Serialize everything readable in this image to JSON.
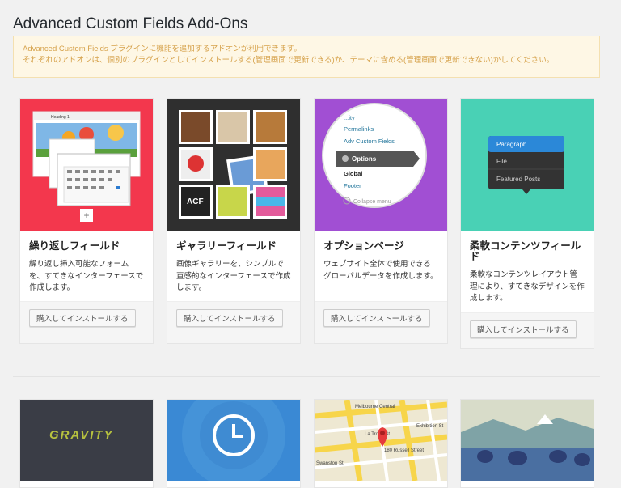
{
  "page": {
    "title": "Advanced Custom Fields Add-Ons"
  },
  "notice": {
    "line1": "Advanced Custom Fields プラグインに機能を追加するアドオンが利用できます。",
    "line2": "それぞれのアドオンは、個別のプラグインとしてインストールする(管理画面で更新できる)か、テーマに含める(管理画面で更新できない)かしてください。"
  },
  "cards": [
    {
      "title": "繰り返しフィールド",
      "desc": "繰り返し挿入可能なフォームを、すてきなインターフェースで作成します。",
      "button": "購入してインストールする"
    },
    {
      "title": "ギャラリーフィールド",
      "desc": "画像ギャラリーを、シンプルで直感的なインターフェースで作成します。",
      "button": "購入してインストールする"
    },
    {
      "title": "オプションページ",
      "desc": "ウェブサイト全体で使用できるグローバルデータを作成します。",
      "button": "購入してインストールする"
    },
    {
      "title": "柔軟コンテンツフィールド",
      "desc": "柔軟なコンテンツレイアウト管理により、すてきなデザインを作成します。",
      "button": "購入してインストールする"
    }
  ],
  "thumbs": {
    "editor_toolbar": "Heading 1",
    "menu_items": [
      "Permalinks",
      "Adv Custom Fields",
      "Options",
      "Global",
      "Footer",
      "Collapse menu"
    ],
    "menu_top": "...ity",
    "flex_items": [
      "Paragraph",
      "File",
      "Featured Posts"
    ],
    "gallery_badge": "ACF",
    "gravity_logo": "GRAVITY",
    "map_labels": [
      "Melbourne Central",
      "La Trobe St",
      "180 Russell Street",
      "Swanston St",
      "Exhibition St"
    ]
  },
  "colors": {
    "red": "#f3374d",
    "dark": "#2f2f2f",
    "purple": "#a14fd3",
    "teal": "#49d1b5",
    "notice_bg": "#fef7e5",
    "notice_text": "#d6a24b"
  }
}
